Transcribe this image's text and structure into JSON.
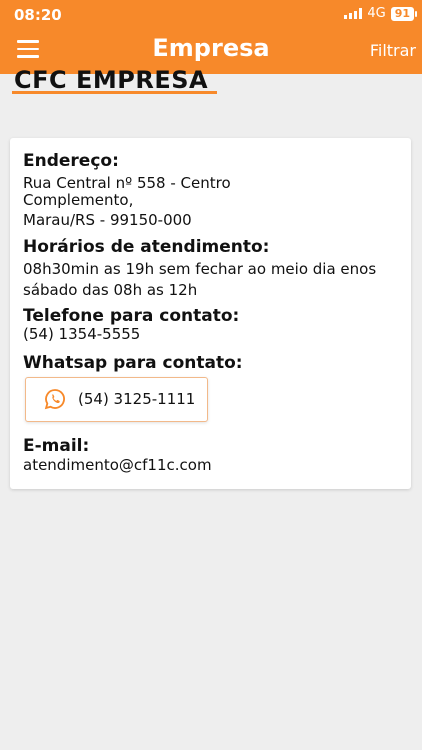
{
  "status_bar": {
    "time": "08:20",
    "network": "4G",
    "battery": "91"
  },
  "header": {
    "title": "Empresa",
    "filter_label": "Filtrar"
  },
  "company": {
    "name": "CFC EMPRESA"
  },
  "address": {
    "label": "Endereço:",
    "line1": "Rua Central nº 558 - Centro",
    "line2": "Complemento,",
    "line3": "Marau/RS - 99150-000"
  },
  "hours": {
    "label": "Horários de atendimento:",
    "line1": "08h30min as 19h sem fechar ao meio dia enos",
    "line2": "sábado das 08h as 12h"
  },
  "phone": {
    "label": "Telefone para contato:",
    "value": "(54) 1354-5555"
  },
  "whatsapp": {
    "label": "Whatsap para contato:",
    "value": "(54) 3125-1111"
  },
  "email": {
    "label": "E-mail:",
    "value": "atendimento@cf11c.com"
  },
  "colors": {
    "accent": "#f7892a"
  },
  "icons": {
    "menu": "hamburger-menu-icon",
    "whatsapp": "whatsapp-icon"
  }
}
